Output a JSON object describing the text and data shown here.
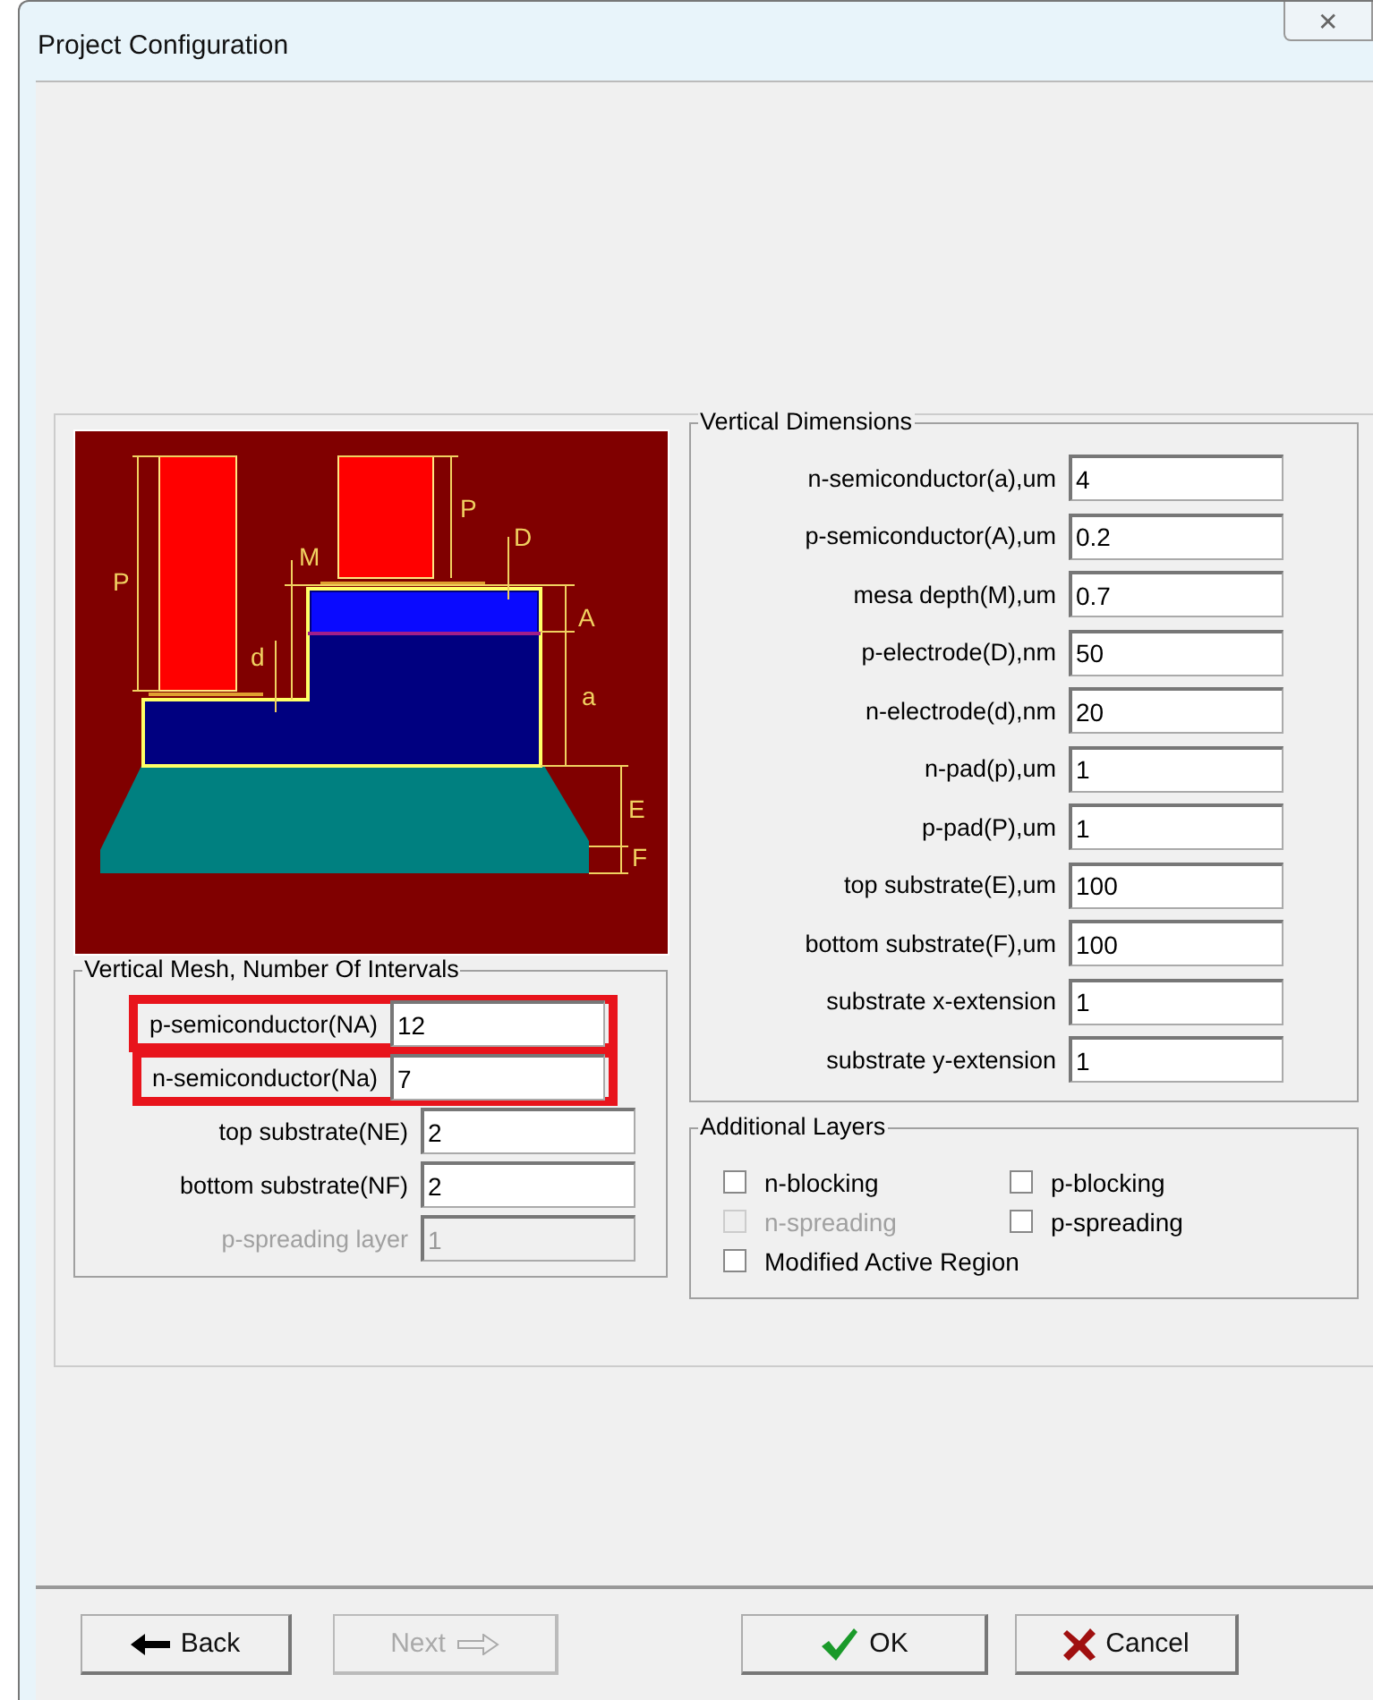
{
  "window": {
    "title": "Project Configuration",
    "close": "✕"
  },
  "diagram": {
    "labels": [
      "P",
      "P",
      "M",
      "D",
      "d",
      "A",
      "a",
      "E",
      "F"
    ]
  },
  "vertical_mesh": {
    "title": "Vertical Mesh, Number Of Intervals",
    "fields": [
      {
        "label": "p-semiconductor(NA)",
        "value": "12",
        "disabled": false,
        "highlighted": true
      },
      {
        "label": "n-semiconductor(Na)",
        "value": "7",
        "disabled": false,
        "highlighted": true
      },
      {
        "label": "top substrate(NE)",
        "value": "2",
        "disabled": false,
        "highlighted": false
      },
      {
        "label": "bottom substrate(NF)",
        "value": "2",
        "disabled": false,
        "highlighted": false
      },
      {
        "label": "p-spreading layer",
        "value": "1",
        "disabled": true,
        "highlighted": false
      }
    ]
  },
  "vertical_dimensions": {
    "title": "Vertical Dimensions",
    "fields": [
      {
        "label": "n-semiconductor(a),um",
        "value": "4"
      },
      {
        "label": "p-semiconductor(A),um",
        "value": "0.2"
      },
      {
        "label": "mesa depth(M),um",
        "value": "0.7"
      },
      {
        "label": "p-electrode(D),nm",
        "value": "50"
      },
      {
        "label": "n-electrode(d),nm",
        "value": "20"
      },
      {
        "label": "n-pad(p),um",
        "value": "1"
      },
      {
        "label": "p-pad(P),um",
        "value": "1"
      },
      {
        "label": "top substrate(E),um",
        "value": "100"
      },
      {
        "label": "bottom substrate(F),um",
        "value": "100"
      },
      {
        "label": "substrate x-extension",
        "value": "1"
      },
      {
        "label": "substrate y-extension",
        "value": "1"
      }
    ]
  },
  "additional_layers": {
    "title": "Additional Layers",
    "options": [
      {
        "label": "n-blocking",
        "checked": false,
        "disabled": false
      },
      {
        "label": "p-blocking",
        "checked": false,
        "disabled": false
      },
      {
        "label": "n-spreading",
        "checked": false,
        "disabled": true
      },
      {
        "label": "p-spreading",
        "checked": false,
        "disabled": false
      },
      {
        "label": "Modified Active Region",
        "checked": false,
        "disabled": false
      }
    ]
  },
  "buttons": [
    {
      "label": "Back",
      "kind": "back",
      "disabled": false
    },
    {
      "label": "Next",
      "kind": "next",
      "disabled": true
    },
    {
      "label": "OK",
      "kind": "ok",
      "disabled": false
    },
    {
      "label": "Cancel",
      "kind": "cancel",
      "disabled": false
    }
  ]
}
